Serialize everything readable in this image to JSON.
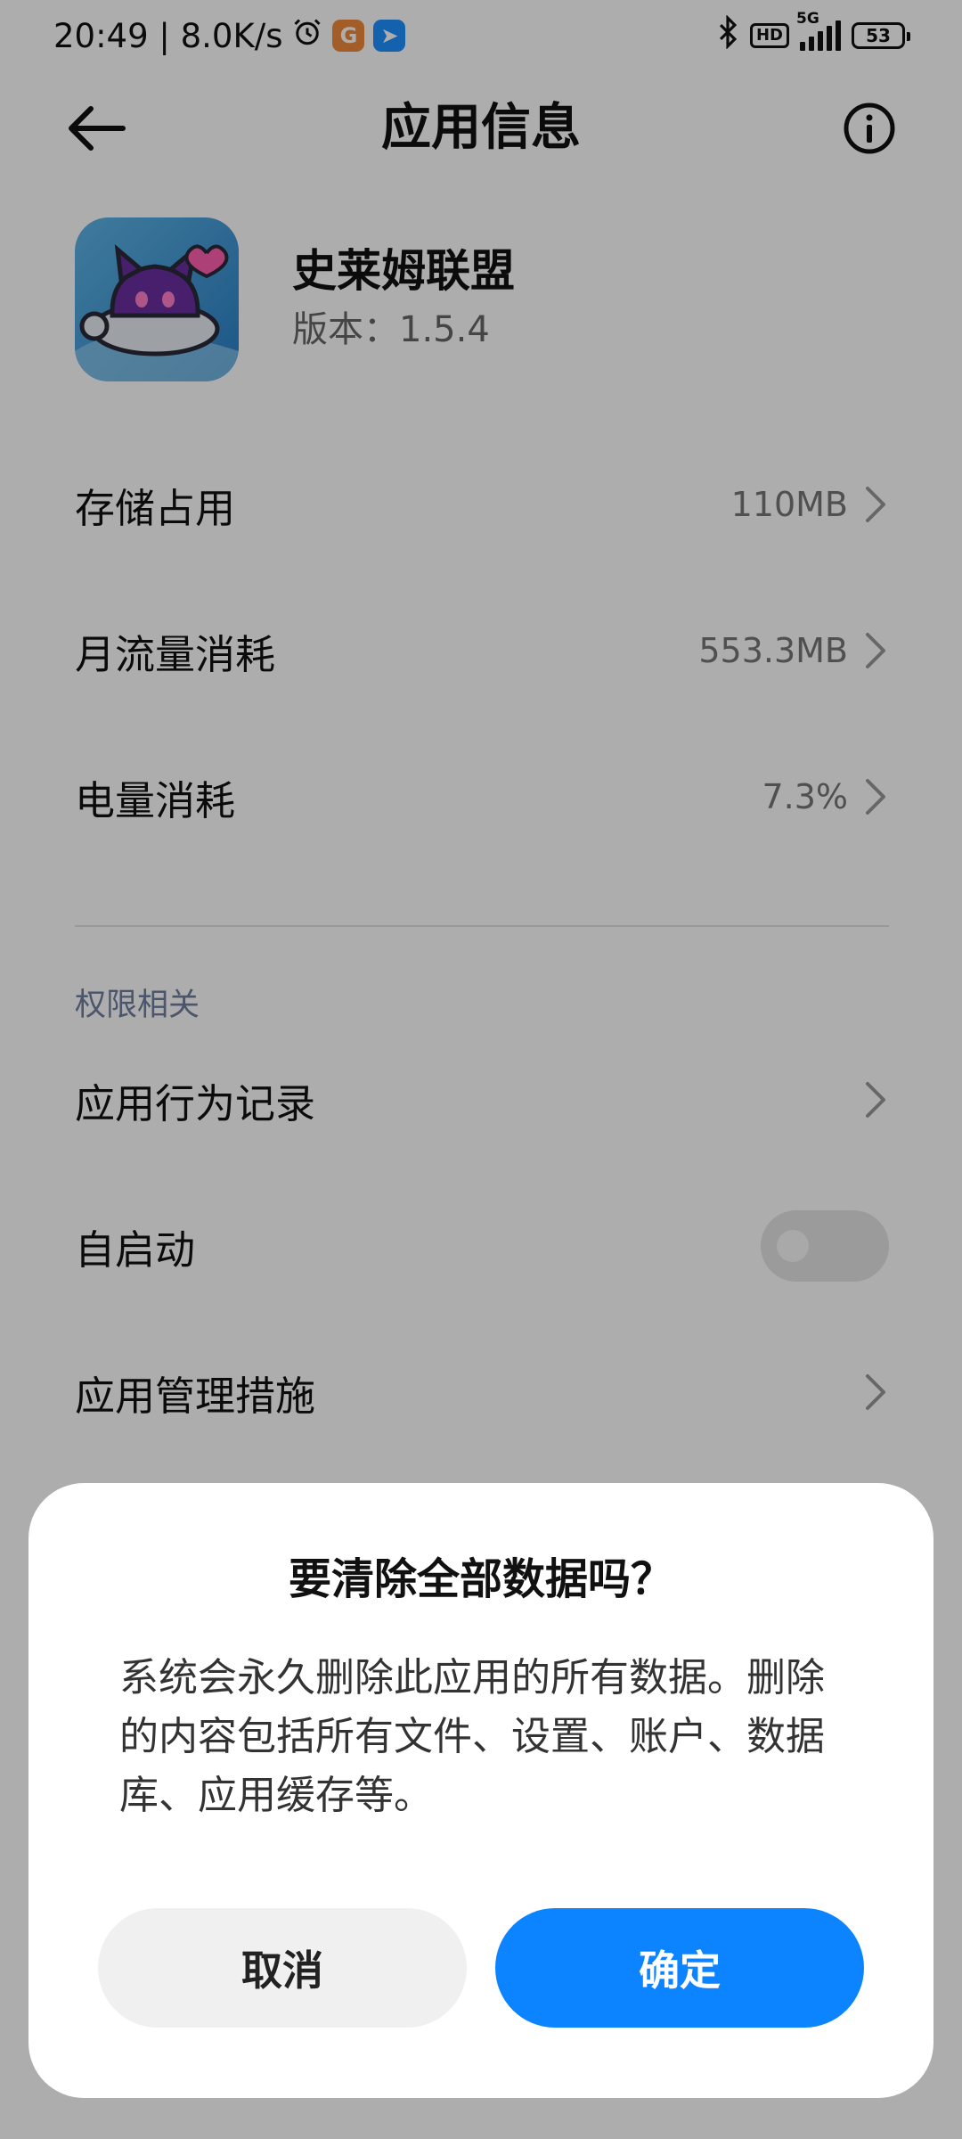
{
  "status_bar": {
    "time_speed": "20:49 | 8.0K/s",
    "network": "5G",
    "hd": "HD",
    "battery": "53",
    "icons": [
      "alarm-icon",
      "browser-app-icon",
      "bird-app-icon",
      "bluetooth-icon",
      "hd-icon",
      "signal-icon",
      "battery-icon"
    ]
  },
  "header": {
    "title": "应用信息",
    "back_icon": "arrow-left-icon",
    "info_icon": "info-icon"
  },
  "app": {
    "name": "史莱姆联盟",
    "version": "版本：1.5.4"
  },
  "rows": {
    "storage": {
      "label": "存储占用",
      "value": "110MB"
    },
    "data": {
      "label": "月流量消耗",
      "value": "553.3MB"
    },
    "battery": {
      "label": "电量消耗",
      "value": "7.3%"
    }
  },
  "permissions": {
    "section_title": "权限相关",
    "behavior": {
      "label": "应用行为记录"
    },
    "autostart": {
      "label": "自启动",
      "enabled": false
    },
    "management": {
      "label": "应用管理措施"
    }
  },
  "dialog": {
    "title": "要清除全部数据吗？",
    "message": "系统会永久删除此应用的所有数据。删除的内容包括所有文件、设置、账户、数据库、应用缓存等。",
    "cancel": "取消",
    "confirm": "确定"
  },
  "colors": {
    "accent": "#0d84ff",
    "overlay": "rgba(0,0,0,0.32)",
    "section_title": "#6f7fa0"
  }
}
